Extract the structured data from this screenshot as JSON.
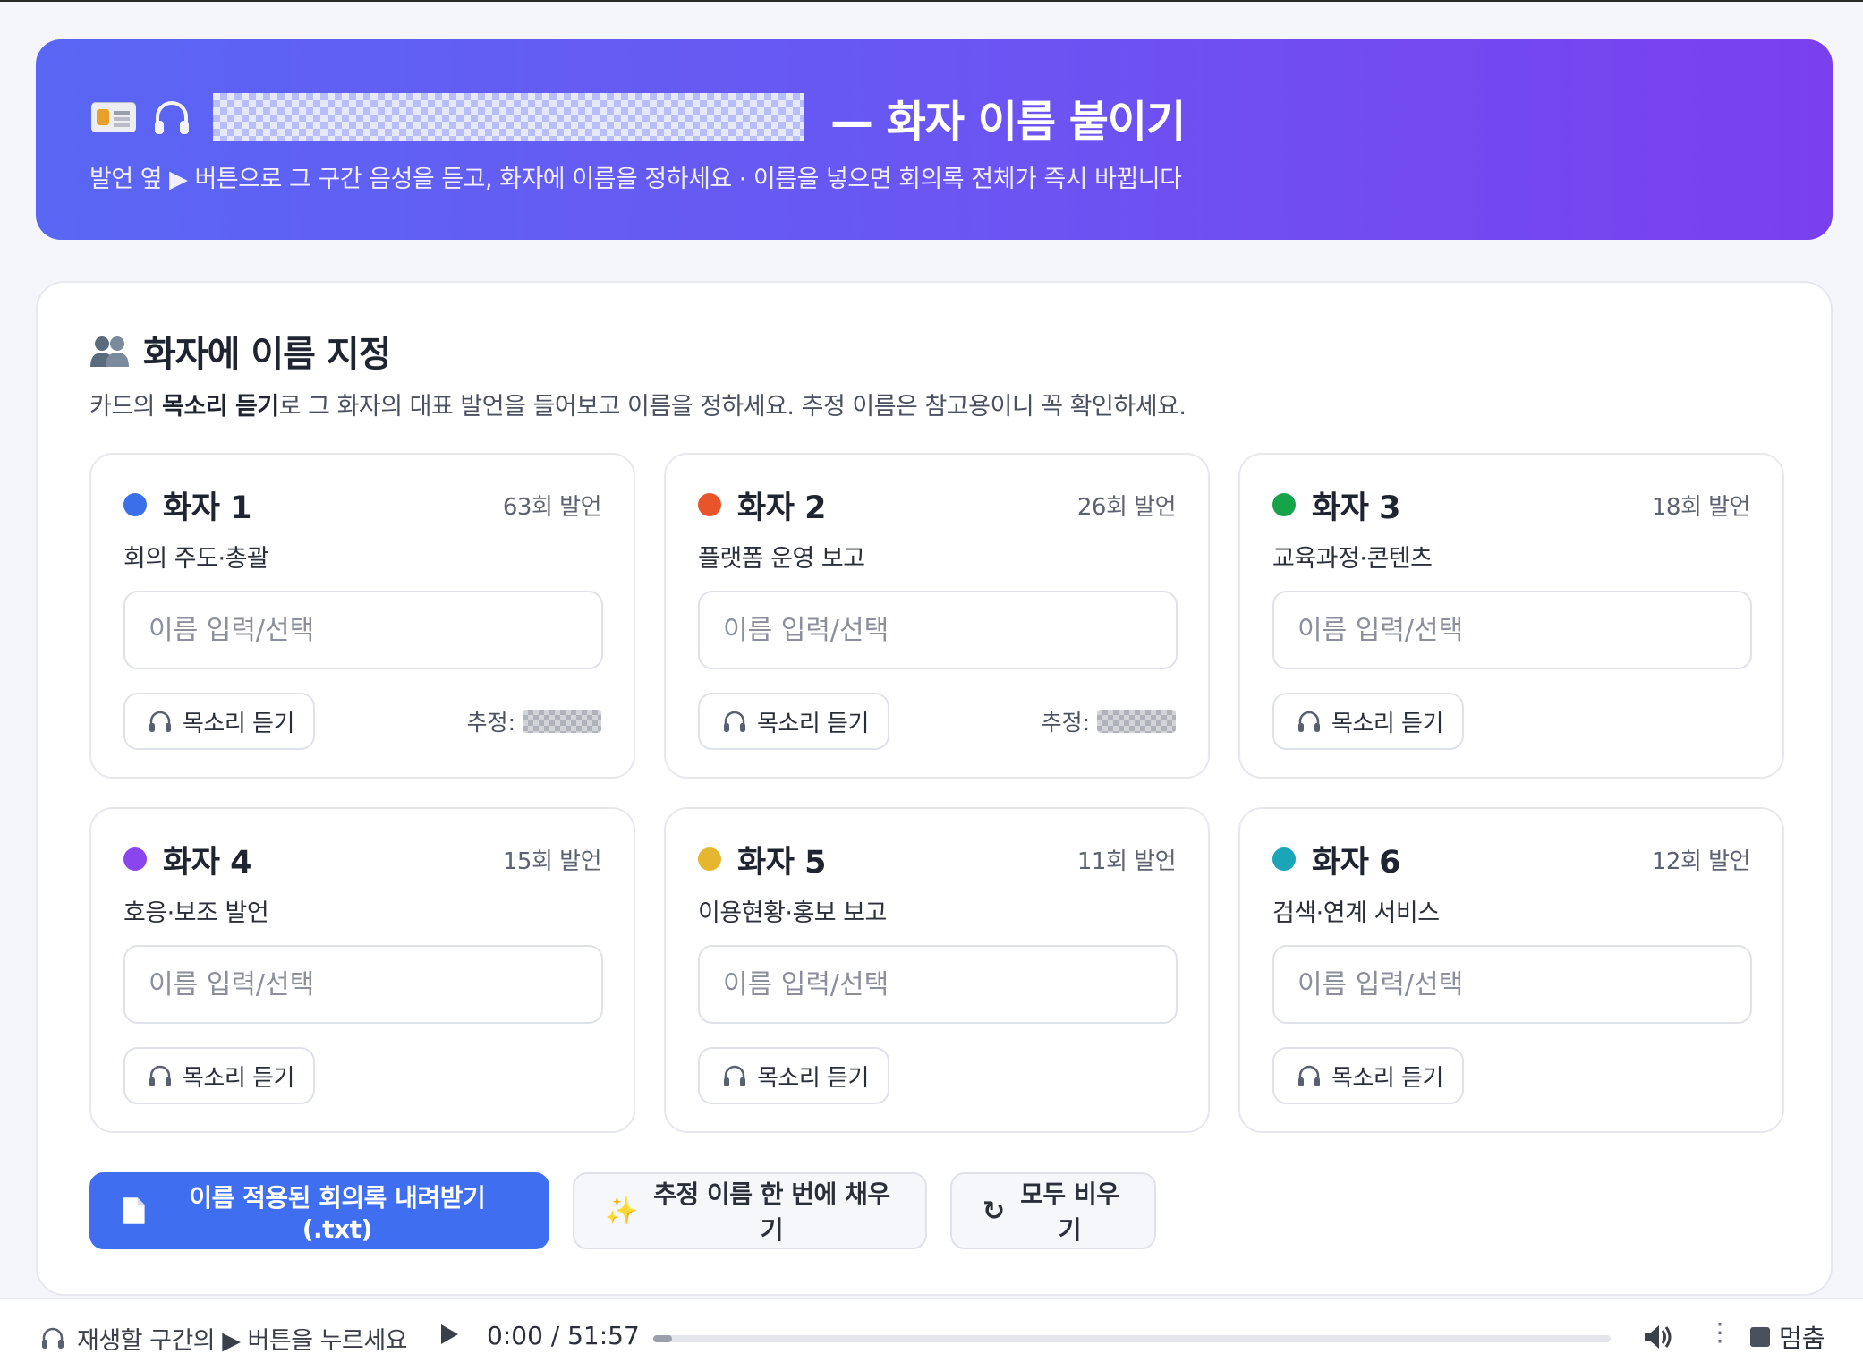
{
  "header": {
    "title": "— 화자 이름 붙이기",
    "subtitle": "발언 옆 ▶ 버튼으로 그 구간 음성을 듣고, 화자에 이름을 정하세요 · 이름을 넣으면 회의록 전체가 즉시 바뀝니다",
    "icons": [
      "id-card-icon",
      "headphones-icon"
    ]
  },
  "section": {
    "title": "화자에 이름 지정",
    "desc_prefix": "카드의 ",
    "desc_bold": "목소리 듣기",
    "desc_suffix": "로 그 화자의 대표 발언을 들어보고 이름을 정하세요. 추정 이름은 참고용이니 꼭 확인하세요."
  },
  "speakers": [
    {
      "name": "화자 1",
      "count": "63회 발언",
      "role": "회의 주도·총괄",
      "color": "#3b6fea",
      "guess_label": "추정:"
    },
    {
      "name": "화자 2",
      "count": "26회 발언",
      "role": "플랫폼 운영 보고",
      "color": "#e8552a",
      "guess_label": "추정:"
    },
    {
      "name": "화자 3",
      "count": "18회 발언",
      "role": "교육과정·콘텐츠",
      "color": "#17a34a"
    },
    {
      "name": "화자 4",
      "count": "15회 발언",
      "role": "호응·보조 발언",
      "color": "#8b45ef"
    },
    {
      "name": "화자 5",
      "count": "11회 발언",
      "role": "이용현황·홍보 보고",
      "color": "#e6b630"
    },
    {
      "name": "화자 6",
      "count": "12회 발언",
      "role": "검색·연계 서비스",
      "color": "#1aa5b8"
    }
  ],
  "card": {
    "input_placeholder": "이름 입력/선택",
    "listen_label": "목소리 듣기"
  },
  "actions": {
    "download": "이름 적용된 회의록 내려받기(.txt)",
    "fill": "추정 이름 한 번에 채우기",
    "clear": "모두 비우기"
  },
  "player": {
    "label": "재생할 구간의 ▶ 버튼을 누르세요",
    "time": "0:00 / 51:57",
    "progress": 0.0,
    "stop_label": "멈춤"
  }
}
